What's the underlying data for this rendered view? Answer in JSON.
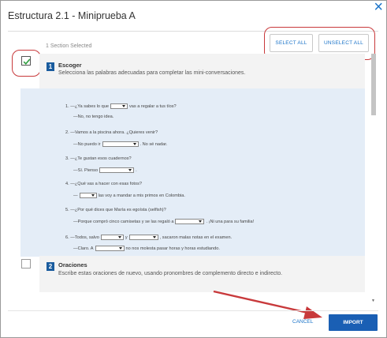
{
  "dialog": {
    "title": "Estructura 2.1 - Miniprueba A",
    "close_icon": "close-icon",
    "selected_count": "1 Section Selected",
    "select_all": "SELECT ALL",
    "unselect_all": "UNSELECT ALL"
  },
  "sections": [
    {
      "number": "1",
      "title": "Escoger",
      "description": "Selecciona las palabras adecuadas para completar las mini-conversaciones.",
      "checked": true,
      "items": [
        {
          "a_pre": "1.  —¿Ya sabes lo que",
          "a_post": "vas a regalar a tus tíos?",
          "b": "—No, no tengo idea."
        },
        {
          "a": "2.  —Vamos a la piscina ahora. ¿Quieres venir?",
          "b_pre": "—No puedo ir",
          "b_post": ". No sé nadar."
        },
        {
          "a": "3.  —¿Te gustan esos cuadernos?",
          "b_pre": "—Sí. Pienso",
          "b_post": "."
        },
        {
          "a": "4.  —¿Qué vas a hacer con esas fotos?",
          "b_pre": "—",
          "b_post": "las voy a mandar a mis primos en Colombia."
        },
        {
          "a": "5.  —¿Por qué dices que María es egoísta (selfish)?",
          "b_pre": "—Porque compró cinco camisetas y se las regaló a",
          "b_post": ". ¡Ni una para su familia!"
        },
        {
          "a_pre": "6.  —Todos, salvo",
          "a_mid": "y",
          "a_post": ", sacaron malas notas en el examen.",
          "b_pre": "—Claro. A",
          "b_post": "no nos molesta pasar horas y horas estudiando."
        }
      ]
    },
    {
      "number": "2",
      "title": "Oraciones",
      "description": "Escribe estas oraciones de nuevo, usando pronombres de complemento directo e indirecto.",
      "checked": false
    }
  ],
  "footer": {
    "cancel": "CANCEL",
    "import": "IMPORT"
  },
  "colors": {
    "accent": "#1a73c8",
    "primary_button": "#1a5fb4",
    "section_number_bg": "#1a5c9e",
    "content_bg": "#e4edf7",
    "annotation": "#c8393b"
  }
}
